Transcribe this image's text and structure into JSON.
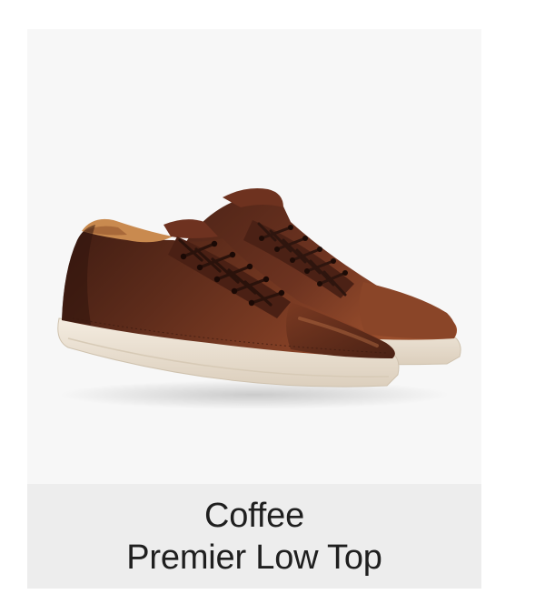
{
  "product": {
    "color_name": "Coffee",
    "model_name": "Premier Low Top",
    "image_icon": "leather-sneaker-pair-image",
    "colors": {
      "card_background": "#f7f7f7",
      "caption_background": "#ededed",
      "text": "#1f1f1f",
      "leather": "#5a2a1b",
      "sole": "#ece2d4"
    }
  }
}
